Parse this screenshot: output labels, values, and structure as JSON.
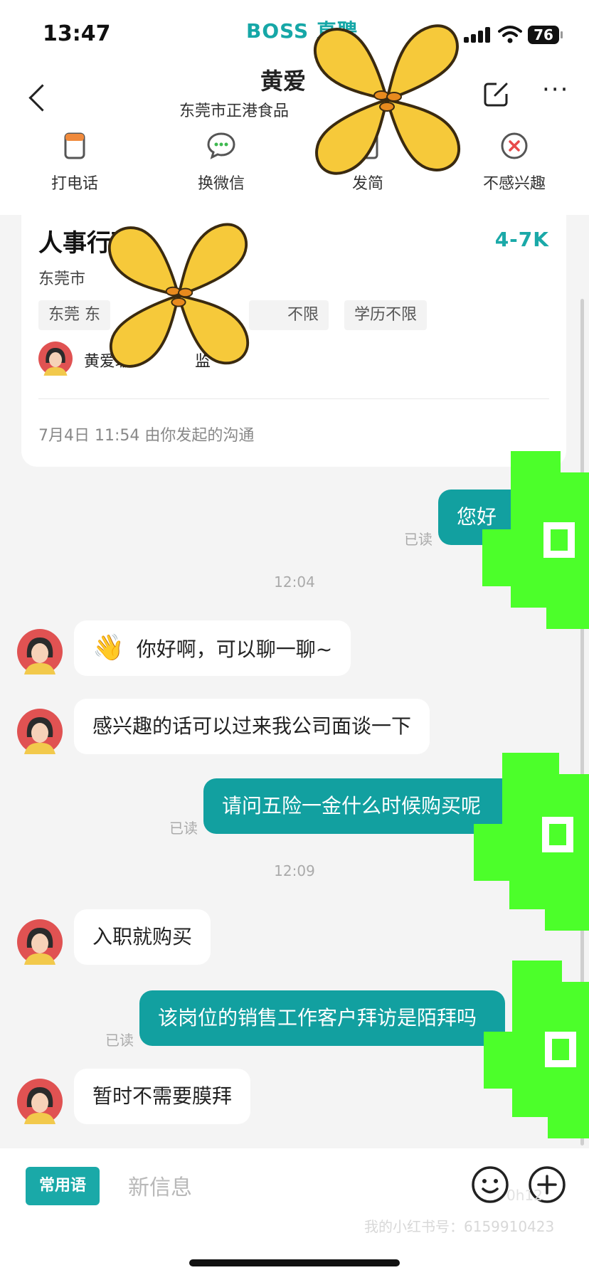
{
  "status_bar": {
    "time": "13:47",
    "brand": "BOSS 直聘",
    "battery": "76"
  },
  "header": {
    "contact_name": "黄爱",
    "company": "东莞市正港食品",
    "actions": [
      {
        "label": "打电话",
        "icon": "phone-card-icon"
      },
      {
        "label": "换微信",
        "icon": "wechat-icon"
      },
      {
        "label": "发简",
        "icon": "resume-icon"
      },
      {
        "label": "不感兴趣",
        "icon": "not-interested-icon"
      }
    ]
  },
  "job_card": {
    "title": "人事行政",
    "salary": "4-7K",
    "location": "东莞市",
    "tags": [
      "东莞 东",
      "不限",
      "学历不限"
    ],
    "recruiter_name": "黄爱珊",
    "recruiter_suffix": "监",
    "footer": "7月4日 11:54 由你发起的沟通"
  },
  "chat": {
    "messages": [
      {
        "from": "me",
        "text": "您好",
        "status": "已读"
      },
      {
        "timestamp": "12:04"
      },
      {
        "from": "them",
        "text": "你好啊，可以聊一聊~",
        "emoji": "👋"
      },
      {
        "from": "them",
        "text": "感兴趣的话可以过来我公司面谈一下"
      },
      {
        "from": "me",
        "text": "请问五险一金什么时候购买呢",
        "status": "已读"
      },
      {
        "timestamp": "12:09"
      },
      {
        "from": "them",
        "text": "入职就购买"
      },
      {
        "from": "me",
        "text": "该岗位的销售工作客户拜访是陌拜吗",
        "status": "已读"
      },
      {
        "from": "them",
        "text": "暂时不需要膜拜"
      }
    ]
  },
  "input_bar": {
    "quick_phrases_label": "常用语",
    "placeholder": "新信息",
    "watermark": "我的小红书号：6159910423",
    "watermark_small": "0h12"
  },
  "colors": {
    "accent": "#1aa9a8",
    "bubble_out": "#12a0a0",
    "sticker_yellow": "#f6c93a",
    "sticker_green": "#4cff2a"
  }
}
